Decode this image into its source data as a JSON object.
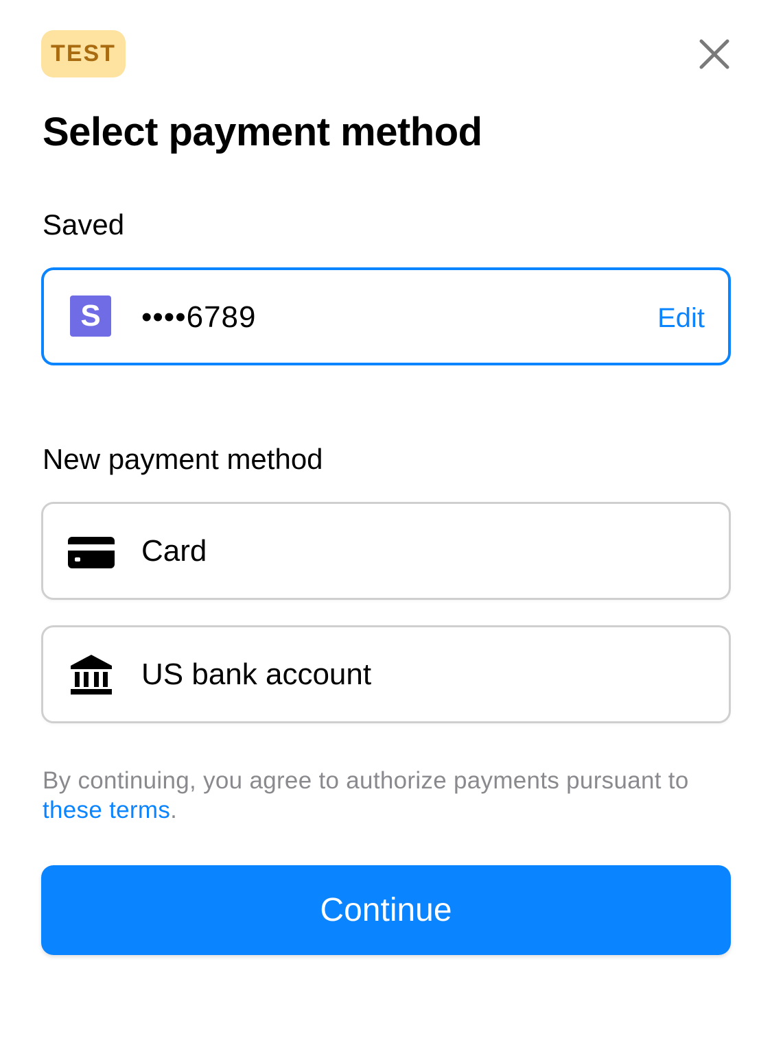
{
  "header": {
    "badge": "TEST",
    "close_icon": "close-icon",
    "title": "Select payment method"
  },
  "saved": {
    "label": "Saved",
    "method": {
      "logo_letter": "S",
      "logo_icon": "link-logo-icon",
      "masked_number": "••••6789",
      "edit_label": "Edit"
    }
  },
  "new_methods": {
    "label": "New payment method",
    "options": [
      {
        "label": "Card",
        "icon": "card-icon"
      },
      {
        "label": "US bank account",
        "icon": "bank-icon"
      }
    ]
  },
  "terms": {
    "prefix": "By continuing, you agree to authorize payments pursuant to ",
    "link": "these terms",
    "suffix": "."
  },
  "footer": {
    "continue_label": "Continue"
  },
  "colors": {
    "accent": "#0A84FF",
    "badge_bg": "#FDE2A0",
    "badge_text": "#A96B10",
    "logo_bg": "#6F6CE6",
    "border": "#CFCFCF",
    "muted_text": "#8A8A8E"
  }
}
